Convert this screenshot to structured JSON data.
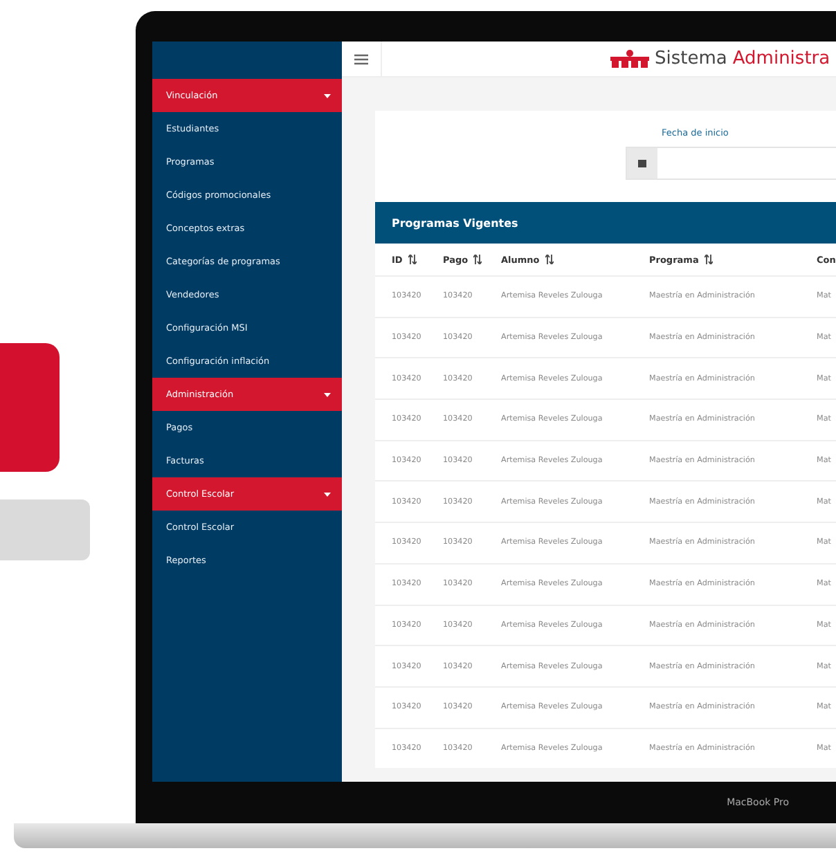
{
  "sidebar": {
    "items": [
      {
        "label": "Vinculación",
        "kind": "section"
      },
      {
        "label": "Estudiantes",
        "kind": "link"
      },
      {
        "label": "Programas",
        "kind": "link"
      },
      {
        "label": "Códigos promocionales",
        "kind": "link"
      },
      {
        "label": "Conceptos extras",
        "kind": "link"
      },
      {
        "label": "Categorías de programas",
        "kind": "link"
      },
      {
        "label": "Vendedores",
        "kind": "link"
      },
      {
        "label": "Configuración MSI",
        "kind": "link"
      },
      {
        "label": "Configuración inflación",
        "kind": "link"
      },
      {
        "label": "Administración",
        "kind": "section"
      },
      {
        "label": "Pagos",
        "kind": "link"
      },
      {
        "label": "Facturas",
        "kind": "link"
      },
      {
        "label": "Control Escolar",
        "kind": "section"
      },
      {
        "label": "Control Escolar",
        "kind": "link"
      },
      {
        "label": "Reportes",
        "kind": "link"
      }
    ]
  },
  "header": {
    "title_prefix": "Sistema",
    "title_highlight": "Administra"
  },
  "filter": {
    "label": "Fecha de inicio"
  },
  "table": {
    "title": "Programas Vigentes",
    "columns": [
      {
        "label": "ID",
        "sortable": true
      },
      {
        "label": "Pago",
        "sortable": true
      },
      {
        "label": "Alumno",
        "sortable": true
      },
      {
        "label": "Programa",
        "sortable": true
      },
      {
        "label": "Con"
      }
    ],
    "rows": [
      [
        "103420",
        "103420",
        "Artemisa Reveles Zulouga",
        "Maestría en Administración",
        "Mat"
      ],
      [
        "103420",
        "103420",
        "Artemisa Reveles Zulouga",
        "Maestría en Administración",
        "Mat"
      ],
      [
        "103420",
        "103420",
        "Artemisa Reveles Zulouga",
        "Maestría en Administración",
        "Mat"
      ],
      [
        "103420",
        "103420",
        "Artemisa Reveles Zulouga",
        "Maestría en Administración",
        "Mat"
      ],
      [
        "103420",
        "103420",
        "Artemisa Reveles Zulouga",
        "Maestría en Administración",
        "Mat"
      ],
      [
        "103420",
        "103420",
        "Artemisa Reveles Zulouga",
        "Maestría en Administración",
        "Mat"
      ],
      [
        "103420",
        "103420",
        "Artemisa Reveles Zulouga",
        "Maestría en Administración",
        "Mat"
      ],
      [
        "103420",
        "103420",
        "Artemisa Reveles Zulouga",
        "Maestría en Administración",
        "Mat"
      ],
      [
        "103420",
        "103420",
        "Artemisa Reveles Zulouga",
        "Maestría en Administración",
        "Mat"
      ],
      [
        "103420",
        "103420",
        "Artemisa Reveles Zulouga",
        "Maestría en Administración",
        "Mat"
      ],
      [
        "103420",
        "103420",
        "Artemisa Reveles Zulouga",
        "Maestría en Administración",
        "Mat"
      ],
      [
        "103420",
        "103420",
        "Artemisa Reveles Zulouga",
        "Maestría en Administración",
        "Mat"
      ]
    ]
  },
  "device_label": "MacBook Pro"
}
